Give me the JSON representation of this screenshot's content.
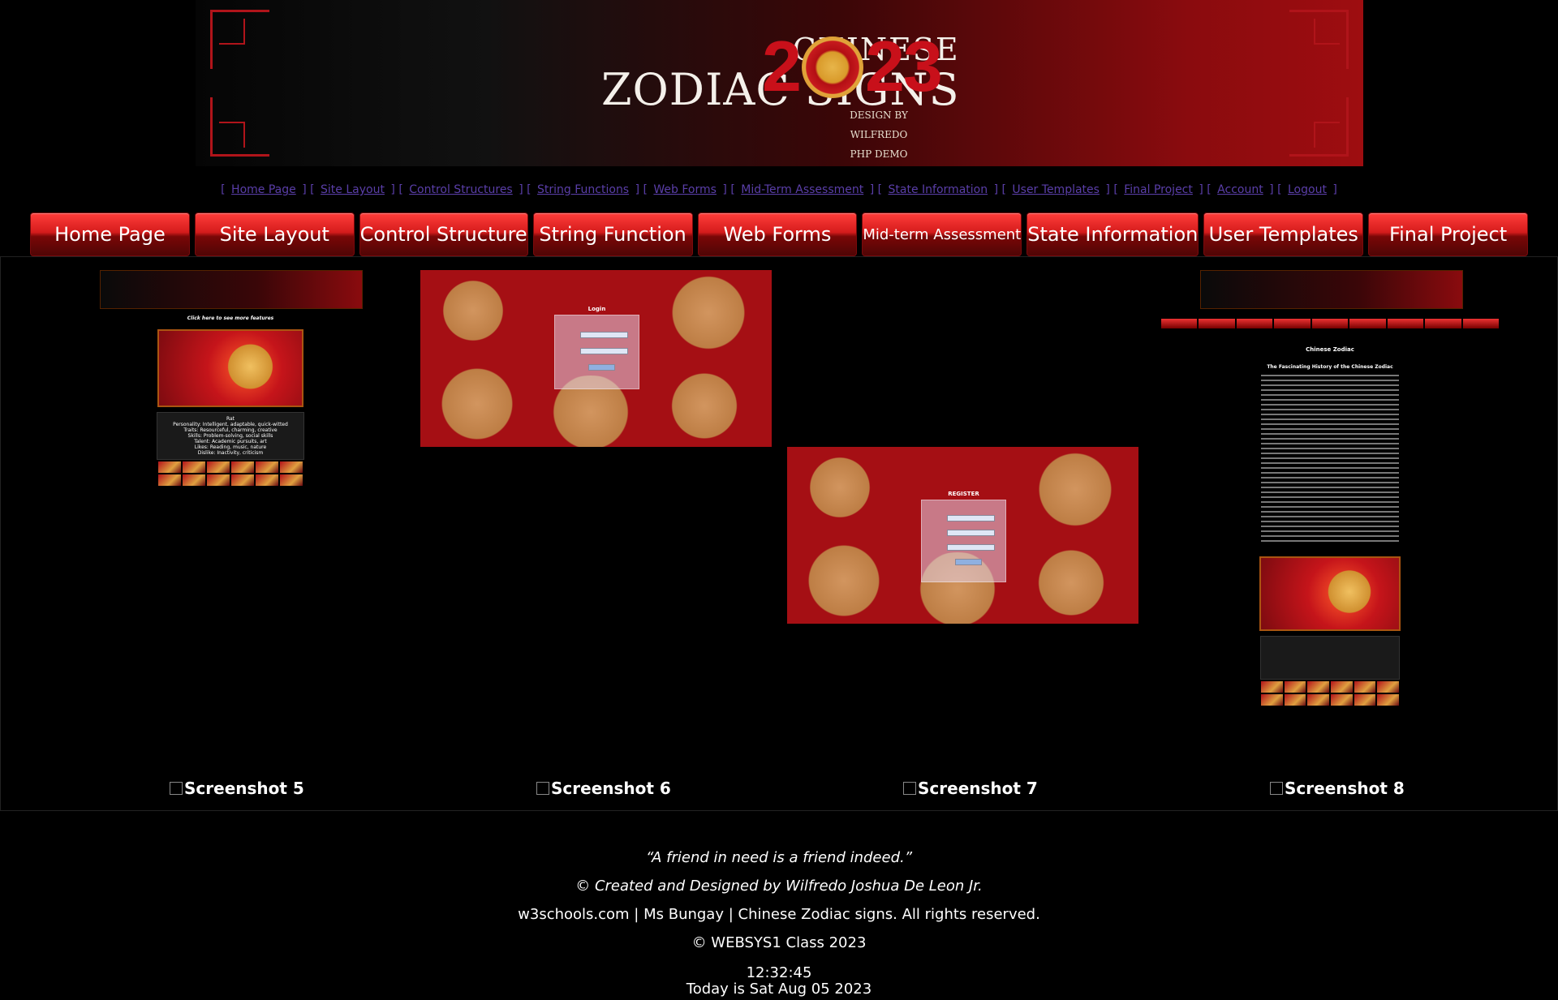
{
  "header": {
    "logo_line1": "CHINESE",
    "logo_line2": "ZODIAC SIGNS",
    "logo_year": "2023",
    "logo_credit": "DESIGN BY WILFREDO",
    "logo_sub": "PHP DEMO"
  },
  "textnav": [
    "Home Page",
    "Site Layout",
    "Control Structures",
    "String Functions",
    "Web Forms",
    "Mid-Term Assessment",
    "State Information",
    "User Templates",
    "Final Project",
    "Account",
    "Logout"
  ],
  "buttons": [
    "Home Page",
    "Site Layout",
    "Control Structure",
    "String Function",
    "Web Forms",
    "Mid-term Assessment",
    "State Information",
    "User Templates",
    "Final Project"
  ],
  "gallery": {
    "captions": [
      "Screenshot 5",
      "Screenshot 6",
      "Screenshot 7",
      "Screenshot 8"
    ],
    "shot5": {
      "more": "Click here to see more features",
      "info": [
        "Rat",
        "Personality: Intelligent, adaptable, quick-witted",
        "Traits: Resourceful, charming, creative",
        "Skills: Problem-solving, social skills",
        "Talent: Academic pursuits, art",
        "Likes: Reading, music, nature",
        "Dislike: Inactivity, criticism"
      ]
    },
    "shot6": {
      "title": "Login"
    },
    "shot7": {
      "title": "REGISTER"
    },
    "shot8": {
      "heading": "Chinese Zodiac",
      "subheading": "The Fascinating History of the Chinese Zodiac"
    }
  },
  "footer": {
    "quote": "“A friend in need is a friend indeed.”",
    "credit": "© Created and Designed by Wilfredo Joshua De Leon Jr.",
    "rights": "w3schools.com | Ms Bungay | Chinese Zodiac signs. All rights reserved.",
    "class": "© WEBSYS1 Class 2023",
    "time": "12:32:45",
    "date": "Today is Sat Aug 05 2023"
  }
}
